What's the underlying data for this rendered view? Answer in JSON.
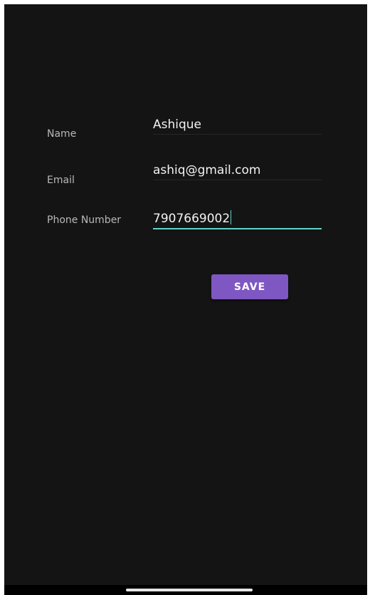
{
  "form": {
    "name_label": "Name",
    "name_value": "Ashique",
    "email_label": "Email",
    "email_value": "ashiq@gmail.com",
    "phone_label": "Phone Number",
    "phone_value": "7907669002"
  },
  "actions": {
    "save_label": "SAVE"
  },
  "colors": {
    "background": "#141414",
    "accent": "#7f57c2",
    "focus_underline": "#5fd3c8"
  }
}
